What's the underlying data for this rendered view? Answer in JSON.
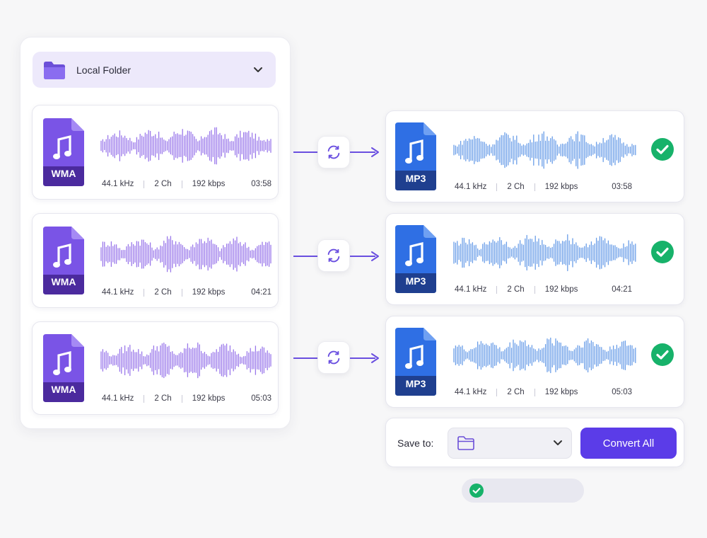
{
  "source": {
    "folder_label": "Local Folder",
    "icon": "folder-icon",
    "files": [
      {
        "format": "WMA",
        "sample_rate": "44.1 kHz",
        "channels": "2 Ch",
        "bitrate": "192 kbps",
        "duration": "03:58"
      },
      {
        "format": "WMA",
        "sample_rate": "44.1 kHz",
        "channels": "2 Ch",
        "bitrate": "192 kbps",
        "duration": "04:21"
      },
      {
        "format": "WMA",
        "sample_rate": "44.1 kHz",
        "channels": "2 Ch",
        "bitrate": "192 kbps",
        "duration": "05:03"
      }
    ]
  },
  "output": {
    "files": [
      {
        "format": "MP3",
        "sample_rate": "44.1 kHz",
        "channels": "2 Ch",
        "bitrate": "192 kbps",
        "duration": "03:58",
        "status": "done"
      },
      {
        "format": "MP3",
        "sample_rate": "44.1 kHz",
        "channels": "2 Ch",
        "bitrate": "192 kbps",
        "duration": "04:21",
        "status": "done"
      },
      {
        "format": "MP3",
        "sample_rate": "44.1 kHz",
        "channels": "2 Ch",
        "bitrate": "192 kbps",
        "duration": "05:03",
        "status": "done"
      }
    ]
  },
  "save": {
    "label": "Save to:",
    "folder_icon": "folder-icon",
    "button_label": "Convert All"
  },
  "colors": {
    "accent": "#5b3ce8",
    "wma_icon": "#7a54e6",
    "wma_band": "#4b2a9e",
    "mp3_icon": "#2f6fe4",
    "mp3_band": "#1f3f8f",
    "wave_source": "#9a78ea",
    "wave_output": "#6a9ee8",
    "check": "#17b26a"
  }
}
